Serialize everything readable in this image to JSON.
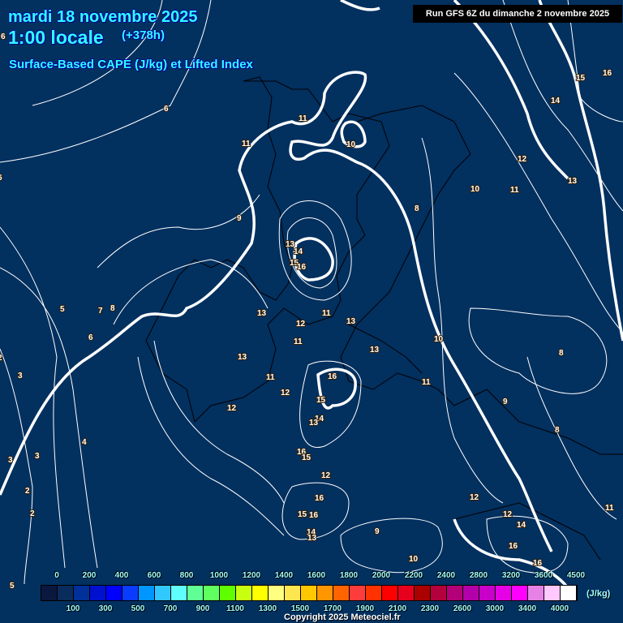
{
  "header": {
    "date": "mardi 18 novembre 2025",
    "local_time": "1:00 locale",
    "lead_time": "(+378h)",
    "subtitle": "Surface-Based CAPE (J/kg) et Lifted Index",
    "run_info": "Run GFS 6Z du dimanche 2 novembre 2025"
  },
  "contour_labels": [
    "6",
    "6",
    "11",
    "10",
    "11",
    "9",
    "8",
    "10",
    "11",
    "12",
    "13",
    "14",
    "15",
    "16",
    "13",
    "14",
    "15",
    "16",
    "13",
    "11",
    "7",
    "8",
    "5",
    "6",
    "12",
    "13",
    "11",
    "13",
    "10",
    "8",
    "13",
    "11",
    "12",
    "16",
    "11",
    "15",
    "9",
    "12",
    "14",
    "13",
    "8",
    "4",
    "16",
    "15",
    "3",
    "3",
    "12",
    "12",
    "2",
    "16",
    "15",
    "16",
    "12",
    "11",
    "14",
    "14",
    "13",
    "9",
    "16",
    "16",
    "10",
    "5",
    "6",
    "3",
    "2",
    "2"
  ],
  "legend": {
    "unit": "(J/kg)",
    "top_labels": [
      "0",
      "200",
      "400",
      "600",
      "800",
      "1000",
      "1200",
      "1400",
      "1600",
      "1800",
      "2000",
      "2200",
      "2400",
      "2800",
      "3200",
      "3600",
      "4500"
    ],
    "bottom_labels": [
      "100",
      "300",
      "500",
      "700",
      "900",
      "1100",
      "1300",
      "1500",
      "1700",
      "1900",
      "2100",
      "2300",
      "2600",
      "3000",
      "3400",
      "4000"
    ],
    "colors": [
      "#0a1840",
      "#0a2c5c",
      "#00309a",
      "#0010d0",
      "#0000ff",
      "#0a3cff",
      "#0096ff",
      "#30c8ff",
      "#60ffff",
      "#60ff96",
      "#60ff60",
      "#60ff00",
      "#c8ff10",
      "#ffff00",
      "#ffff80",
      "#ffe650",
      "#ffc800",
      "#ff9600",
      "#ff6400",
      "#ff3c3c",
      "#ff3200",
      "#ff0000",
      "#e6001e",
      "#aa0000",
      "#b4003c",
      "#b40078",
      "#b400aa",
      "#c800c8",
      "#e600e6",
      "#ff00ff",
      "#e682e6",
      "#ffc8ff",
      "#ffffff"
    ]
  },
  "copyright": "Copyright 2025 Meteociel.fr"
}
